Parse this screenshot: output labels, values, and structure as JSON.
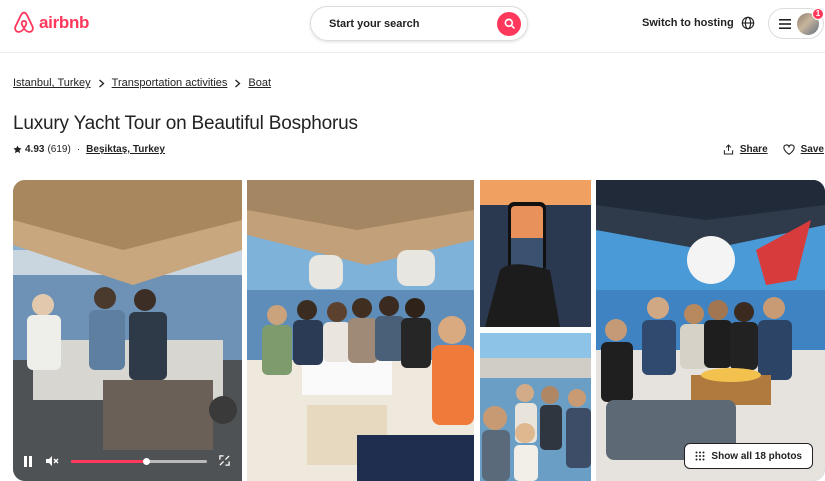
{
  "header": {
    "logo_text": "airbnb",
    "search_placeholder": "Start your search",
    "switch_hosting": "Switch to hosting",
    "notification_count": "1"
  },
  "breadcrumb": [
    "Istanbul, Turkey",
    "Transportation activities",
    "Boat"
  ],
  "listing": {
    "title": "Luxury Yacht Tour on Beautiful Bosphorus",
    "rating": "4.93",
    "reviews": "(619)",
    "location": "Beşiktaş, Turkey",
    "share_label": "Share",
    "save_label": "Save"
  },
  "gallery": {
    "show_all_label": "Show all 18 photos",
    "video_progress": 0.55
  },
  "colors": {
    "brand": "#ff385c",
    "text": "#222222",
    "border": "#dddddd"
  },
  "icons": [
    "airbnb-logo-icon",
    "search-icon",
    "globe-icon",
    "menu-icon",
    "star-icon",
    "share-icon",
    "heart-icon",
    "pause-icon",
    "mute-icon",
    "fullscreen-icon",
    "grid-icon",
    "chevron-right-icon"
  ]
}
